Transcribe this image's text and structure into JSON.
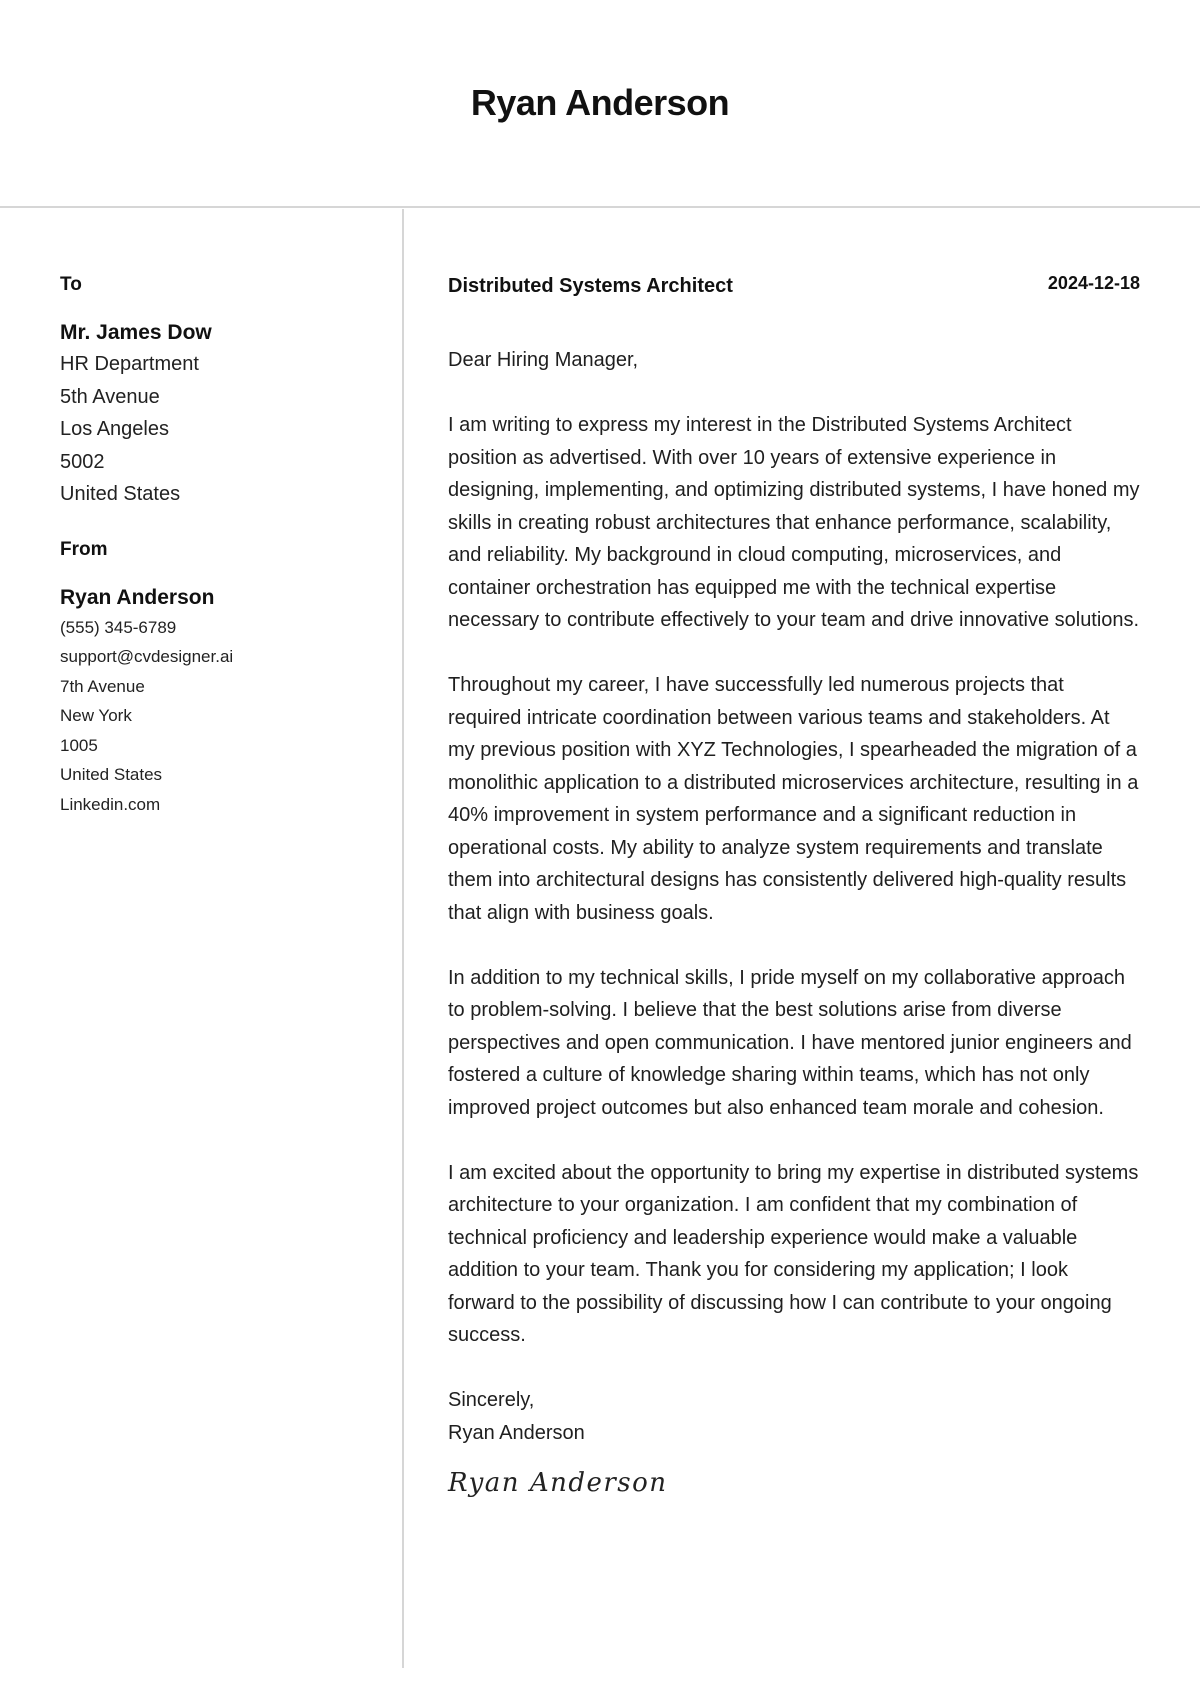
{
  "header": {
    "name": "Ryan Anderson"
  },
  "recipient": {
    "label": "To",
    "name": "Mr. James Dow",
    "lines": [
      "HR Department",
      "5th Avenue",
      "Los Angeles",
      "5002",
      "United States"
    ]
  },
  "sender": {
    "label": "From",
    "name": "Ryan Anderson",
    "lines": [
      "(555) 345-6789",
      "support@cvdesigner.ai",
      "7th Avenue",
      "New York",
      "1005",
      "United States",
      "Linkedin.com"
    ]
  },
  "letter": {
    "job_title": "Distributed Systems Architect",
    "date": "2024-12-18",
    "salutation": "Dear Hiring Manager,",
    "paragraphs": [
      "I am writing to express my interest in the Distributed Systems Architect position as advertised. With over 10 years of extensive experience in designing, implementing, and optimizing distributed systems, I have honed my skills in creating robust architectures that enhance performance, scalability, and reliability. My background in cloud computing, microservices, and container orchestration has equipped me with the technical expertise necessary to contribute effectively to your team and drive innovative solutions.",
      "Throughout my career, I have successfully led numerous projects that required intricate coordination between various teams and stakeholders. At my previous position with XYZ Technologies, I spearheaded the migration of a monolithic application to a distributed microservices architecture, resulting in a 40% improvement in system performance and a significant reduction in operational costs. My ability to analyze system requirements and translate them into architectural designs has consistently delivered high-quality results that align with business goals.",
      "In addition to my technical skills, I pride myself on my collaborative approach to problem-solving. I believe that the best solutions arise from diverse perspectives and open communication. I have mentored junior engineers and fostered a culture of knowledge sharing within teams, which has not only improved project outcomes but also enhanced team morale and cohesion.",
      "I am excited about the opportunity to bring my expertise in distributed systems architecture to your organization. I am confident that my combination of technical proficiency and leadership experience would make a valuable addition to your team. Thank you for considering my application; I look forward to the possibility of discussing how I can contribute to your ongoing success."
    ],
    "closing": "Sincerely,",
    "closing_name": "Ryan Anderson",
    "signature": "Ryan Anderson"
  }
}
